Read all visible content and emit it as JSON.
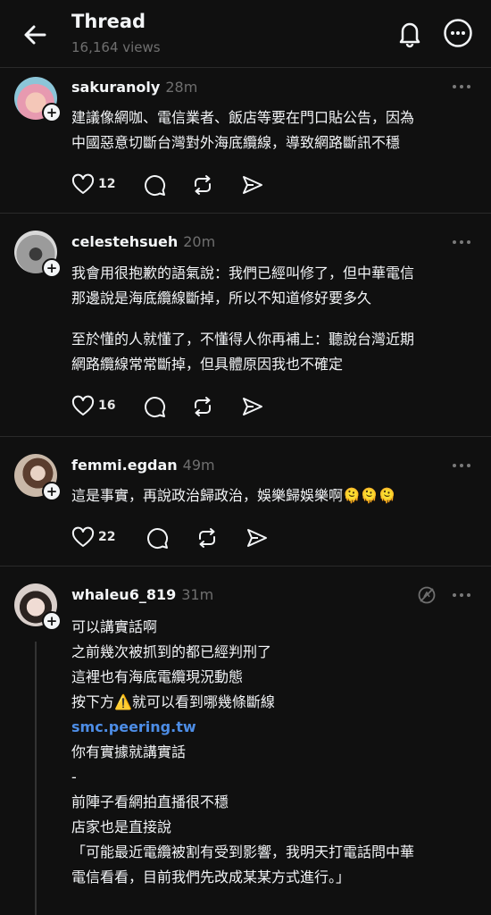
{
  "header": {
    "title": "Thread",
    "views": "16,164 views"
  },
  "posts": [
    {
      "username": "sakuranoly",
      "time": "28m",
      "text_lines": [
        "建議像網咖、電信業者、飯店等要在門口貼公告，因為",
        "中國惡意切斷台灣對外海底纜線，導致網路斷訊不穩"
      ],
      "likes": "12"
    },
    {
      "username": "celestehsueh",
      "time": "20m",
      "text_lines": [
        "我會用很抱歉的語氣說：我們已經叫修了，但中華電信",
        "那邊說是海底纜線斷掉，所以不知道修好要多久"
      ],
      "text_lines_2": [
        "至於懂的人就懂了，不懂得人你再補上：聽說台灣近期",
        "網路纜線常常斷掉，但具體原因我也不確定"
      ],
      "likes": "16"
    },
    {
      "username": "femmi.egdan",
      "time": "49m",
      "text": "這是事實，再說政治歸政治，娛樂歸娛樂啊🫠🫠🫠",
      "likes": "22"
    },
    {
      "username": "whaleu6_819",
      "time": "31m",
      "lines": [
        "可以講實話啊",
        "之前幾次被抓到的都已經判刑了",
        "這裡也有海底電纜現況動態",
        "按下方⚠️就可以看到哪幾條斷線",
        "smc.peering.tw",
        "你有實據就講實話",
        "-",
        "前陣子看網拍直播很不穩",
        "店家也是直接說",
        "「可能最近電纜被割有受到影響，我明天打電話問中華",
        "電信看看，目前我們先改成某某方式進行。」"
      ]
    }
  ],
  "icons": {
    "back": "arrow-left-icon",
    "notifications": "bell-icon",
    "more": "more-horizontal-icon",
    "like": "heart-icon",
    "comment": "comment-icon",
    "repost": "repost-icon",
    "share": "send-icon",
    "translate": "translate-off-icon"
  },
  "colors": {
    "background": "#101010",
    "text": "#f3f5f7",
    "muted": "#6f6f6f",
    "link": "#4d8de6"
  }
}
